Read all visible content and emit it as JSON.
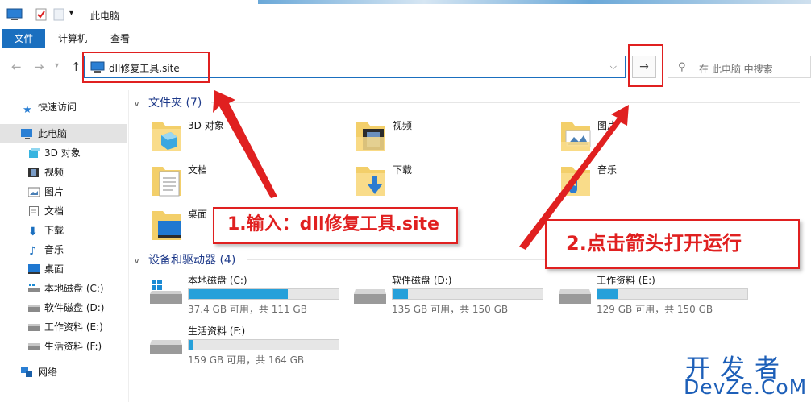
{
  "window": {
    "title": "此电脑"
  },
  "ribbon": {
    "tabs": [
      {
        "label": "文件"
      },
      {
        "label": "计算机"
      },
      {
        "label": "查看"
      }
    ]
  },
  "address": {
    "value": "dll修复工具.site",
    "go_icon": "→"
  },
  "search": {
    "placeholder": "在 此电脑 中搜索"
  },
  "sidebar": {
    "items": [
      {
        "label": "快速访问",
        "icon": "star-icon"
      },
      {
        "label": "此电脑",
        "icon": "computer-icon",
        "active": true
      },
      {
        "label": "3D 对象",
        "icon": "cube-icon"
      },
      {
        "label": "视频",
        "icon": "film-icon"
      },
      {
        "label": "图片",
        "icon": "picture-icon"
      },
      {
        "label": "文档",
        "icon": "document-icon"
      },
      {
        "label": "下载",
        "icon": "download-icon"
      },
      {
        "label": "音乐",
        "icon": "music-icon"
      },
      {
        "label": "桌面",
        "icon": "desktop-icon"
      },
      {
        "label": "本地磁盘 (C:)",
        "icon": "drive-icon"
      },
      {
        "label": "软件磁盘 (D:)",
        "icon": "drive-icon"
      },
      {
        "label": "工作资料 (E:)",
        "icon": "drive-icon"
      },
      {
        "label": "生活资料 (F:)",
        "icon": "drive-icon"
      },
      {
        "label": "网络",
        "icon": "network-icon"
      }
    ]
  },
  "folders_section": {
    "title": "文件夹 (7)",
    "items": [
      {
        "name": "3D 对象",
        "icon": "3d-objects-folder-icon"
      },
      {
        "name": "视频",
        "icon": "videos-folder-icon"
      },
      {
        "name": "图片",
        "icon": "pictures-folder-icon"
      },
      {
        "name": "文档",
        "icon": "documents-folder-icon"
      },
      {
        "name": "下载",
        "icon": "downloads-folder-icon"
      },
      {
        "name": "音乐",
        "icon": "music-folder-icon"
      },
      {
        "name": "桌面",
        "icon": "desktop-folder-icon"
      }
    ]
  },
  "drives_section": {
    "title": "设备和驱动器 (4)",
    "items": [
      {
        "name": "本地磁盘 (C:)",
        "info": "37.4 GB 可用，共 111 GB",
        "used_fraction": 0.66
      },
      {
        "name": "软件磁盘 (D:)",
        "info": "135 GB 可用，共 150 GB",
        "used_fraction": 0.1
      },
      {
        "name": "工作资料 (E:)",
        "info": "129 GB 可用，共 150 GB",
        "used_fraction": 0.14
      },
      {
        "name": "生活资料 (F:)",
        "info": "159 GB 可用，共 164 GB",
        "used_fraction": 0.03
      }
    ]
  },
  "annotations": {
    "step1": "1.输入：dll修复工具.site",
    "step2": "2.点击箭头打开运行"
  },
  "watermark": {
    "line1": "开发者",
    "line2": "DevZe.CoM"
  },
  "colors": {
    "accent": "#1a6fbf",
    "annotation": "#e02020",
    "drive_fill": "#26a0da"
  }
}
